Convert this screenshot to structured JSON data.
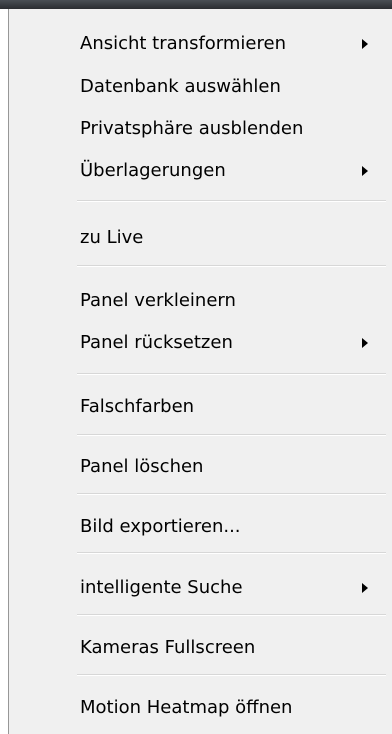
{
  "context_menu": {
    "items": [
      {
        "label": "Ansicht transformieren",
        "submenu_icon": "chevron-right-icon"
      },
      {
        "label": "Datenbank auswählen"
      },
      {
        "label": "Privatsphäre ausblenden"
      },
      {
        "label": "Überlagerungen",
        "submenu_icon": "chevron-right-icon"
      },
      {
        "label": "zu Live"
      },
      {
        "label": "Panel verkleinern"
      },
      {
        "label": "Panel rücksetzen",
        "submenu_icon": "chevron-right-icon"
      },
      {
        "label": "Falschfarben"
      },
      {
        "label": "Panel löschen"
      },
      {
        "label": "Bild exportieren..."
      },
      {
        "label": "intelligente Suche",
        "submenu_icon": "chevron-right-icon"
      },
      {
        "label": "Kameras Fullscreen"
      },
      {
        "label": "Motion Heatmap öffnen"
      }
    ]
  },
  "colors": {
    "menu_background": "#f0f0f0",
    "separator": "#d7d7d7",
    "text": "#000000"
  }
}
